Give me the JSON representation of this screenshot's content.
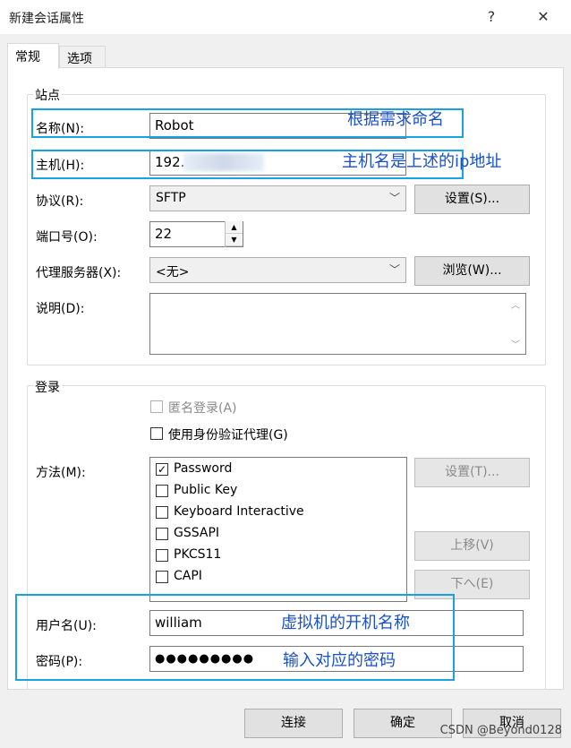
{
  "window": {
    "title": "新建会话属性",
    "help_label": "?",
    "close_label": "✕"
  },
  "tabs": [
    {
      "label": "常规"
    },
    {
      "label": "选项"
    }
  ],
  "site": {
    "group_label": "站点",
    "name_label": "名称(N):",
    "name_value": "Robot",
    "host_label": "主机(H):",
    "host_value": "192.",
    "protocol_label": "协议(R):",
    "protocol_value": "SFTP",
    "protocol_settings": "设置(S)...",
    "port_label": "端口号(O):",
    "port_value": "22",
    "proxy_label": "代理服务器(X):",
    "proxy_value": "<无>",
    "proxy_browse": "浏览(W)...",
    "desc_label": "说明(D):"
  },
  "login": {
    "group_label": "登录",
    "anonymous_label": "匿名登录(A)",
    "agent_label": "使用身份验证代理(G)",
    "method_label": "方法(M):",
    "methods": [
      {
        "label": "Password",
        "checked": true
      },
      {
        "label": "Public Key",
        "checked": false
      },
      {
        "label": "Keyboard Interactive",
        "checked": false
      },
      {
        "label": "GSSAPI",
        "checked": false
      },
      {
        "label": "PKCS11",
        "checked": false
      },
      {
        "label": "CAPI",
        "checked": false
      }
    ],
    "check_mark": "✓",
    "settings_label": "设置(T)...",
    "up_label": "上移(V)",
    "down_label": "下へ(E)",
    "user_label": "用户名(U):",
    "user_value": "william",
    "password_label": "密码(P):",
    "password_value": "●●●●●●●●●"
  },
  "annotations": {
    "name_note": "根据需求命名",
    "host_note": "主机名是上述的ip地址",
    "user_note": "虚拟机的开机名称",
    "password_note": "输入对应的密码",
    "color": "#1ba1e2"
  },
  "footer": {
    "connect": "连接",
    "ok": "确定",
    "cancel": "取消"
  },
  "watermark": "CSDN @Beyond0128"
}
